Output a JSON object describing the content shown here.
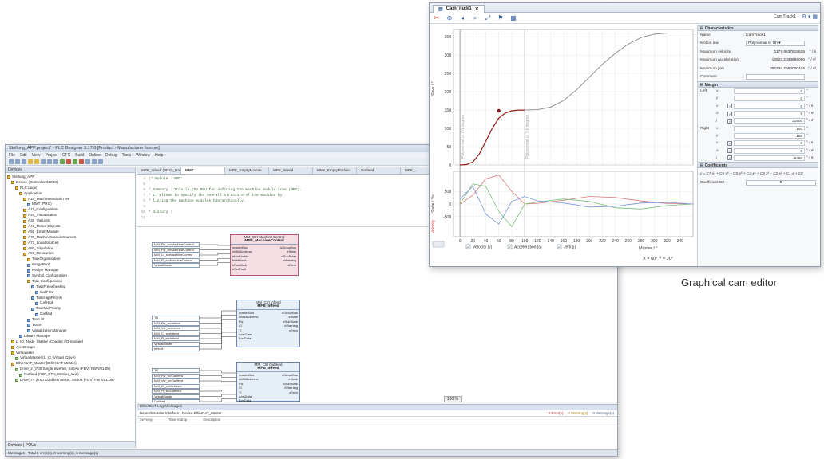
{
  "ide": {
    "title": "Stellung_APP.project* - PLC Designer 3.17.0 [Product - Manufacturer license]",
    "menu": [
      "File",
      "Edit",
      "View",
      "Project",
      "CFC",
      "Build",
      "Online",
      "Debug",
      "Tools",
      "Window",
      "Help"
    ],
    "devices_pane_title": "Devices",
    "devices_footer": "Devices | POUs",
    "status_bar": "Messages - Total 0 error(s), 0 warning(s), 0 message(s)",
    "tree": [
      {
        "level": 0,
        "label": "Stellung_APP",
        "icon": "project-icon"
      },
      {
        "level": 1,
        "label": "Device (Controller 3200C)",
        "icon": "device-icon"
      },
      {
        "level": 2,
        "label": "PLC Logic",
        "icon": "folder-icon"
      },
      {
        "level": 3,
        "label": "Application",
        "icon": "folder-icon"
      },
      {
        "level": 4,
        "label": "A10_MachineModuleTree",
        "icon": "folder-icon"
      },
      {
        "level": 5,
        "label": "MMT (PRG)",
        "icon": "function-icon"
      },
      {
        "level": 4,
        "label": "A11_Configuration",
        "icon": "folder-icon"
      },
      {
        "level": 4,
        "label": "A20_Visualisation",
        "icon": "folder-icon"
      },
      {
        "level": 4,
        "label": "A30_VarLists",
        "icon": "folder-icon"
      },
      {
        "level": 4,
        "label": "A40_MotionObjects",
        "icon": "folder-icon"
      },
      {
        "level": 4,
        "label": "A50_EmptyModule",
        "icon": "folder-icon"
      },
      {
        "level": 4,
        "label": "A70_MachineModuleSources",
        "icon": "folder-icon"
      },
      {
        "level": 4,
        "label": "A71_LocalSources",
        "icon": "folder-icon"
      },
      {
        "level": 4,
        "label": "A80_Simulation",
        "icon": "folder-icon"
      },
      {
        "level": 4,
        "label": "A90_Resources",
        "icon": "folder-icon"
      },
      {
        "level": 5,
        "label": "TaskOrganisation",
        "icon": "folder-icon"
      },
      {
        "level": 5,
        "label": "ImagePool",
        "icon": "function-icon"
      },
      {
        "level": 5,
        "label": "Recipe Manager",
        "icon": "function-icon"
      },
      {
        "level": 5,
        "label": "Symbol Configuration",
        "icon": "function-icon"
      },
      {
        "level": 5,
        "label": "Task Configuration",
        "icon": "folder-icon"
      },
      {
        "level": 6,
        "label": "TaskFreewheeling",
        "icon": "function-icon"
      },
      {
        "level": 7,
        "label": "CallFree",
        "icon": "function-icon"
      },
      {
        "level": 6,
        "label": "TaskHighPriority",
        "icon": "function-icon"
      },
      {
        "level": 7,
        "label": "CallHigh",
        "icon": "function-icon"
      },
      {
        "level": 6,
        "label": "TaskMidPriority",
        "icon": "function-icon"
      },
      {
        "level": 7,
        "label": "CallMid",
        "icon": "function-icon"
      },
      {
        "level": 5,
        "label": "TextList",
        "icon": "function-icon"
      },
      {
        "level": 5,
        "label": "Trace",
        "icon": "function-icon"
      },
      {
        "level": 5,
        "label": "VisualizationManager",
        "icon": "function-icon"
      },
      {
        "level": 3,
        "label": "Library Manager",
        "icon": "function-icon"
      },
      {
        "level": 1,
        "label": "L_IO_Node_Master (Coupler I/O module)",
        "icon": "device-icon"
      },
      {
        "level": 1,
        "label": "AxisGroups",
        "icon": "folder-icon"
      },
      {
        "level": 1,
        "label": "Virtualaxes",
        "icon": "folder-icon"
      },
      {
        "level": 2,
        "label": "VirtualMaster (L_IX_Virtual_Drive)",
        "icon": "drive-icon"
      },
      {
        "level": 1,
        "label": "EtherCAT_Master (EtherCAT Master)",
        "icon": "device-icon"
      },
      {
        "level": 2,
        "label": "Drive_2 (i700 Single Inverter, SoftAx (FDV) FW V01.08)",
        "icon": "drive-icon"
      },
      {
        "level": 3,
        "label": "Outfeed (i700_ETH_Motion_Axis)",
        "icon": "drive-icon"
      },
      {
        "level": 2,
        "label": "Drive_74 (i700 Double Inverter, SoftAx (FDV) FW V01.08)",
        "icon": "drive-icon"
      }
    ],
    "editor_tabs": [
      "MPE_Infeed (PRG)_BaseFunction",
      "MMT",
      "MPE_EmptyModule",
      "MPE_Infeed",
      "MMe_EmptyModule",
      "Outfeed",
      "MPE_..."
    ],
    "active_tab_index": 1,
    "code_lines": [
      {
        "num": "4",
        "text": "(* Module :     MMT"
      },
      {
        "num": "5",
        "text": ""
      },
      {
        "num": "6",
        "text": " * Summary :    This is the POU for defining the machine module tree (MMT)."
      },
      {
        "num": "7",
        "text": " *              It allows to specify the overall structure of the machine by"
      },
      {
        "num": "8",
        "text": " *              listing the machine modules hierarchically."
      },
      {
        "num": "9",
        "text": ""
      },
      {
        "num": "10",
        "text": " * History :"
      },
      {
        "num": "11",
        "text": ""
      }
    ],
    "blocks": [
      {
        "instance": "MM_Ctrl MachineControl",
        "type": "MFB_MachineControl",
        "inputs": [
          "masterBus",
          "inMMAddress",
          "bHwEnable",
          "bInitMode",
          "bFaultAck",
          "bSetFault"
        ],
        "outputs": [
          "sGroupBus",
          "eState",
          "eSubState",
          "xWarning",
          "xError"
        ],
        "extra_inputs": [
          "Master",
          "Master Bus"
        ],
        "wired": [
          "MM_Fw_scrMachineControl",
          "MM_Fw_scrMachineControl",
          "MM_Cl_scrMachineControl",
          "MM_Fl_scrMachineControl",
          "VirtualMaster"
        ],
        "highlight": true
      },
      {
        "instance": "MM_Ctrl Infeed",
        "type": "MFB_Infeed",
        "inputs": [
          "masterBus",
          "inMMAddress",
          "Fw",
          "Cl",
          "Tl",
          "AxisData",
          "EnvData"
        ],
        "outputs": [
          "sGroupBus",
          "eState",
          "eSubState",
          "xWarning",
          "xError"
        ],
        "extra_inputs": [
          "Master Bus",
          "Env"
        ],
        "wired": [
          "TS",
          "MM_Fw_scrInfeed",
          "MM_Vw_scrInfeed",
          "MM_Cl_scrInfeed",
          "MM_Fl_scrInfeed",
          "VirtualMaster",
          "Infeed"
        ],
        "highlight": false
      },
      {
        "instance": "MM_Ctrl Outfeed",
        "type": "MFB_Infeed",
        "inputs": [
          "masterBus",
          "inMMAddress",
          "Fw",
          "Cl",
          "Tl",
          "AxisData",
          "EnvData"
        ],
        "outputs": [
          "sGroupBus",
          "eState",
          "eSubState",
          "xWarning",
          "xError"
        ],
        "extra_inputs": [
          "Master Bus",
          "Env"
        ],
        "wired": [
          "TS",
          "MM_Fw_scrOutfeed",
          "MM_Vw_scrOutfeed",
          "MM_Cl_scrOutfeed",
          "MM_Fl_scrOutfeed",
          "VirtualMaster",
          "Outfeed"
        ],
        "highlight": false
      }
    ],
    "zoom": "100 %",
    "messages": {
      "title": "EtherCAT Log Messages",
      "tabs": [
        "Network Master Interface",
        "Device EtherCAT_Master"
      ],
      "columns": [
        "Severity",
        "Time Stamp",
        "Description"
      ],
      "errors": "0 Error(s)",
      "warnings": "0 Warning(s)",
      "infos": "0 Message(s)"
    }
  },
  "cam": {
    "tab_title": "CamTrack1",
    "header_right_label": "CamTrack1",
    "toolbar_icons": [
      "cut-icon",
      "add-point-icon",
      "move-icon",
      "zoom-in-icon",
      "zoom-fit-icon",
      "flag-icon",
      "table-icon"
    ],
    "status_readout": "X = 60°   Y = 30°",
    "x_axis_title": "Master / °",
    "upper_y_title": "Slave / °",
    "lower_y_title": "Slave / °/s",
    "lower_y_label_2": "Velocity",
    "segment_labels": [
      "Polynomial of 7th degree",
      "Polynomial of 7th degree"
    ],
    "checkbox_labels": [
      "Velocity [v]",
      "Acceleration [a]",
      "Jerk [j]"
    ],
    "characteristics": {
      "title": "Characteristics",
      "rows": [
        {
          "key": "Name",
          "value": "CamTrack1",
          "unit": ""
        },
        {
          "key": "Motion law",
          "value": "Polynomial of 7th",
          "unit": ""
        },
        {
          "key": "Maximum velocity",
          "value": "1177.8637815625",
          "unit": "° / s"
        },
        {
          "key": "Maximum acceleration",
          "value": "14523.2043658096",
          "unit": "° / s²"
        },
        {
          "key": "Maximum jerk",
          "value": "364234.7650000425",
          "unit": "° / s³"
        },
        {
          "key": "Comment",
          "value": "",
          "unit": ""
        }
      ]
    },
    "margin": {
      "title": "Margin",
      "rows": [
        {
          "side": "Left",
          "sym": "x",
          "checked": null,
          "value": "0",
          "unit": "°"
        },
        {
          "side": "",
          "sym": "y",
          "checked": null,
          "value": "0",
          "unit": "°"
        },
        {
          "side": "",
          "sym": "v",
          "checked": true,
          "value": "0",
          "unit": "° / s"
        },
        {
          "side": "",
          "sym": "a",
          "checked": true,
          "value": "0",
          "unit": "° / s²"
        },
        {
          "side": "",
          "sym": "j",
          "checked": true,
          "value": "21600",
          "unit": "° / s³"
        },
        {
          "side": "Right",
          "sym": "x",
          "checked": null,
          "value": "100",
          "unit": "°"
        },
        {
          "side": "",
          "sym": "y",
          "checked": null,
          "value": "150",
          "unit": "°"
        },
        {
          "side": "",
          "sym": "v",
          "checked": true,
          "value": "0",
          "unit": "° / s"
        },
        {
          "side": "",
          "sym": "a",
          "checked": true,
          "value": "0",
          "unit": "° / s²"
        },
        {
          "side": "",
          "sym": "j",
          "checked": true,
          "value": "-6480",
          "unit": "° / s³"
        }
      ]
    },
    "coefficients": {
      "title": "Coefficients",
      "formula": "y = C7·x⁷ + C6·x⁶ + C5·x⁵ + C4·x⁴ + C3·x³ + C2·x² + C1·x + C0",
      "row_key": "Coefficient C0",
      "row_value": "0"
    }
  },
  "caption": "Graphical cam editor",
  "chart_data": {
    "type": "line",
    "upper_plot": {
      "ylabel": "Slave / °",
      "yticks": [
        0,
        50,
        100,
        150,
        200,
        250,
        300,
        350
      ],
      "ylim": [
        0,
        370
      ],
      "series": [
        {
          "x": [
            0,
            10,
            20,
            30,
            40,
            50,
            60,
            70,
            80,
            90,
            100
          ],
          "y": [
            0,
            1,
            8,
            30,
            65,
            100,
            128,
            142,
            148,
            150,
            150
          ]
        },
        {
          "x": [
            100,
            120,
            140,
            160,
            180,
            200,
            220,
            240,
            260,
            280,
            300,
            320,
            340,
            360
          ],
          "y": [
            150,
            151,
            158,
            176,
            205,
            240,
            275,
            305,
            330,
            348,
            357,
            360,
            360,
            360
          ]
        }
      ],
      "selected_point": {
        "x": 60,
        "y": 148
      }
    },
    "lower_plot": {
      "ylabel": "Slave / °/s",
      "yticks": [
        500,
        0,
        -500
      ],
      "series": [
        {
          "name": "Velocity [v]",
          "color": "#d97b7b",
          "x": [
            0,
            20,
            40,
            60,
            80,
            100,
            120,
            160,
            200,
            240,
            280,
            320,
            360
          ],
          "y": [
            0,
            350,
            1000,
            1150,
            500,
            0,
            30,
            150,
            300,
            260,
            120,
            20,
            0
          ]
        },
        {
          "name": "Acceleration [a]",
          "color": "#7bbf7b",
          "x": [
            0,
            20,
            40,
            60,
            80,
            100,
            120,
            160,
            200,
            240,
            280,
            320,
            360
          ],
          "y": [
            0,
            800,
            700,
            -300,
            -900,
            0,
            80,
            200,
            100,
            -150,
            -200,
            -60,
            0
          ]
        },
        {
          "name": "Jerk [j]",
          "color": "#7b95d9",
          "x": [
            0,
            20,
            40,
            60,
            80,
            100,
            120,
            160,
            200,
            240,
            280,
            320,
            360
          ],
          "y": [
            200,
            700,
            -400,
            -800,
            100,
            300,
            120,
            40,
            -120,
            -90,
            40,
            60,
            0
          ]
        }
      ]
    },
    "xticks": [
      0,
      20,
      40,
      60,
      80,
      100,
      120,
      140,
      160,
      180,
      200,
      220,
      240,
      260,
      280,
      300,
      320,
      340
    ],
    "xlabel": "Master / °",
    "xlim": [
      -10,
      360
    ],
    "segment_boundaries": [
      0,
      100
    ]
  },
  "colors": {
    "highlight_block": "#f5dde4",
    "normal_block": "#e6eef8",
    "curve": "#555555",
    "selected_segment": "#8b1a1a"
  }
}
